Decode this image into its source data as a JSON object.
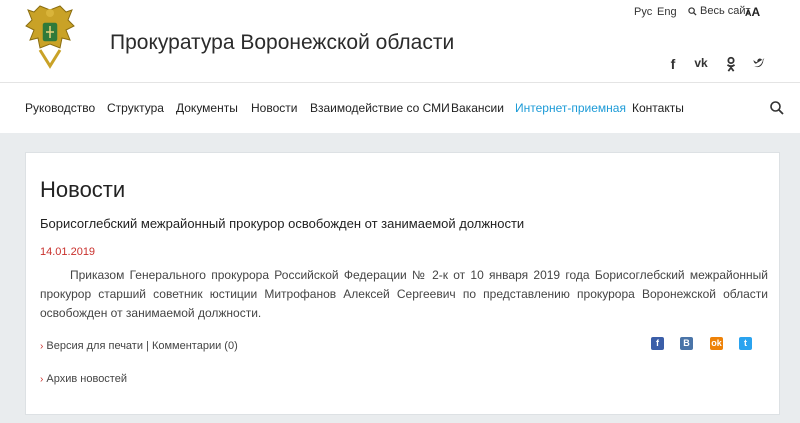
{
  "header": {
    "site_title": "Прокуратура Воронежской области",
    "lang_ru": "Рус",
    "lang_en": "Eng",
    "whole_site": "Весь сайт",
    "font_size_small": "A",
    "font_size_large": "A"
  },
  "social": {
    "facebook": "f",
    "vk": "vk",
    "odnoklassniki": "ok",
    "twitter": "t"
  },
  "nav": {
    "items": [
      "Руководство",
      "Структура",
      "Документы",
      "Новости",
      "Взаимодействие со СМИ",
      "Вакансии",
      "Интернет-приемная",
      "Контакты"
    ]
  },
  "content": {
    "page_title": "Новости",
    "news_title": "Борисоглебский межрайонный прокурор освобожден от занимаемой должности",
    "date": "14.01.2019",
    "body": "Приказом Генерального прокурора Российской Федерации № 2-к от 10 января 2019 года Борисоглебский межрайонный прокурор старший советник юстиции Митрофанов Алексей Сергеевич по представлению прокурора Воронежской области освобожден от занимаемой должности.",
    "print_version": "Версия для печати",
    "separator": "|",
    "comments": "Комментарии (0)",
    "archive": "Архив новостей",
    "bullet": "›"
  },
  "share": {
    "facebook": "f",
    "vk": "B",
    "odnoklassniki": "ok",
    "twitter": "t"
  },
  "colors": {
    "accent_link": "#1d9bd7",
    "date_red": "#c9302c",
    "background": "#e9ecee"
  }
}
